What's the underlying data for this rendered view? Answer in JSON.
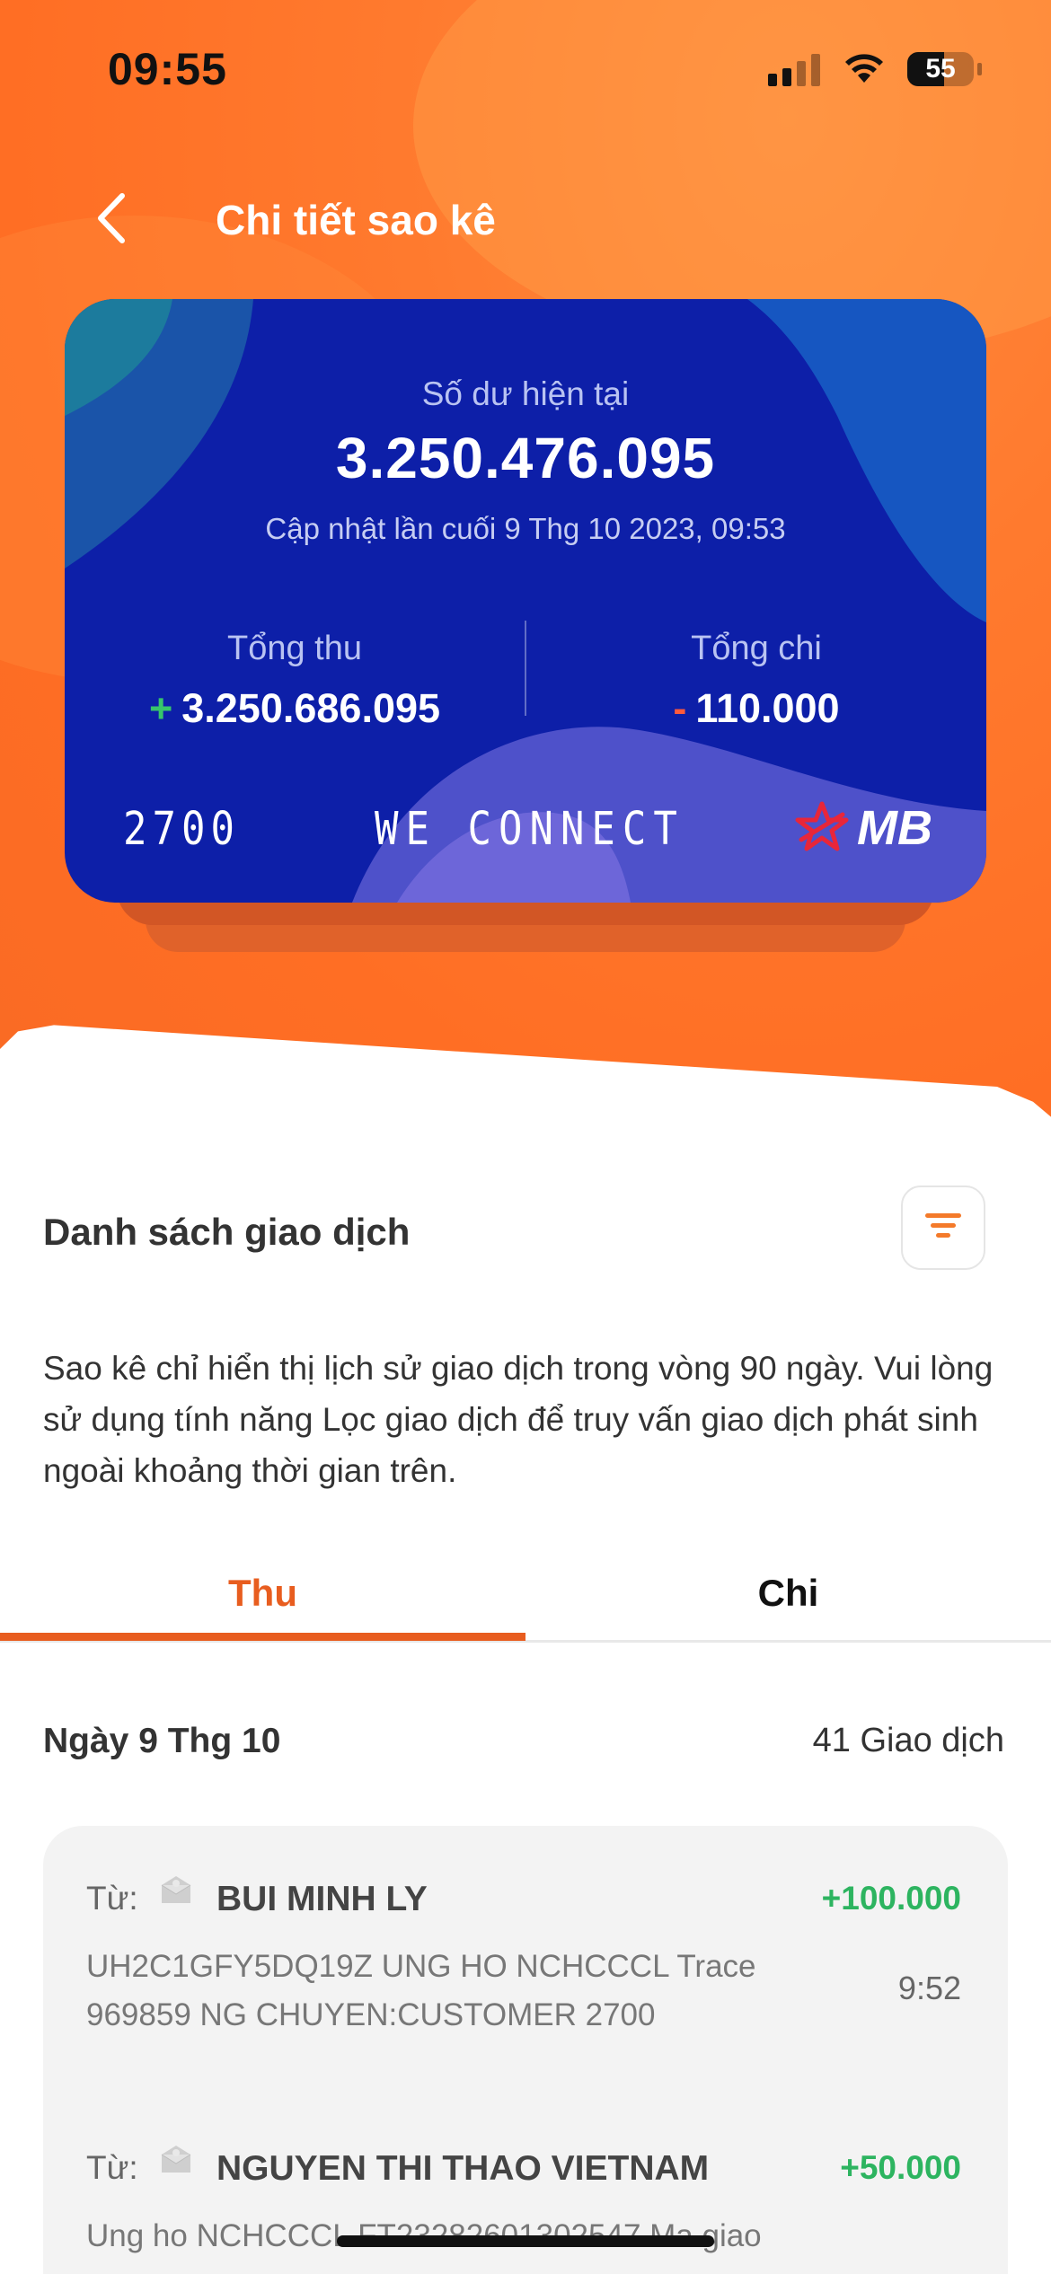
{
  "status_bar": {
    "time": "09:55",
    "battery": "55",
    "battery_level": 0.55
  },
  "nav": {
    "title": "Chi tiết sao kê"
  },
  "card": {
    "balance_label": "Số dư hiện tại",
    "balance": "3.250.476.095",
    "updated": "Cập nhật lần cuối 9 Thg 10 2023, 09:53",
    "income_label": "Tổng thu",
    "income_sign": "+",
    "income_value": "3.250.686.095",
    "expense_label": "Tổng chi",
    "expense_sign": "-",
    "expense_value": "110.000",
    "account_suffix": "2700",
    "slogan": "WE CONNECT",
    "logo_text": "MB",
    "colors": {
      "card": "#0d1fa8",
      "income_sign": "#37c56b",
      "expense_sign": "#ff5a3c"
    }
  },
  "transactions_section": {
    "title": "Danh sách giao dịch",
    "filter_icon": "filter-icon",
    "notice": "Sao kê chỉ hiển thị lịch sử giao dịch trong vòng 90 ngày. Vui lòng sử dụng tính năng Lọc giao dịch để truy vấn giao dịch phát sinh ngoài khoảng thời gian trên."
  },
  "tabs": [
    {
      "label": "Thu",
      "active": true
    },
    {
      "label": "Chi",
      "active": false
    }
  ],
  "day_group": {
    "date": "Ngày 9 Thg 10",
    "count": "41 Giao dịch",
    "transactions": [
      {
        "from_label": "Từ:",
        "name": "BUI MINH LY",
        "amount": "+100.000",
        "description": "UH2C1GFY5DQ19Z UNG HO NCHCCCL Trace 969859 NG CHUYEN:CUSTOMER 2700",
        "time": "9:52"
      },
      {
        "from_label": "Từ:",
        "name": "NGUYEN THI THAO VIETNAM",
        "amount": "+50.000",
        "description": "Ung ho NCHCCCL FT23282601302547 Ma giao",
        "time": ""
      }
    ]
  },
  "theme": {
    "accent": "#e85d1f",
    "positive": "#2db460",
    "header": "#ff7a2e"
  }
}
